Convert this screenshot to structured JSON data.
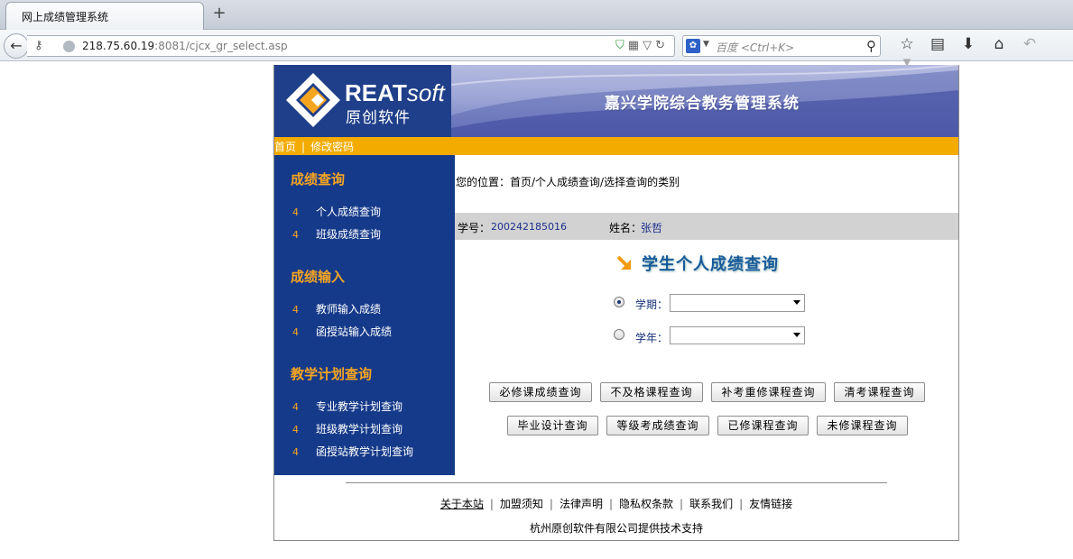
{
  "browser": {
    "tab_title": "网上成绩管理系统",
    "new_tab": "+",
    "url_host": "218.75.60.19",
    "url_rest": ":8081/cjcx_gr_select.asp",
    "search_placeholder": "百度 <Ctrl+K>",
    "search_engine_glyph": "✿"
  },
  "header": {
    "logo_brand": "REAT",
    "logo_brand_italic": "soft",
    "logo_cn": "原创软件",
    "system_title": "嘉兴学院综合教务管理系统",
    "colors": {
      "logo_bg": "#1f3f8a",
      "nav_bar": "#f3ab00",
      "sidebar": "#163a8a",
      "accent": "#f6a521"
    }
  },
  "topnav": {
    "home": "首页",
    "separator": "|",
    "change_password": "修改密码"
  },
  "sidebar": {
    "sections": [
      {
        "title": "成绩查询",
        "items": [
          {
            "bullet": "4",
            "label": "个人成绩查询"
          },
          {
            "bullet": "4",
            "label": "班级成绩查询"
          }
        ]
      },
      {
        "title": "成绩输入",
        "items": [
          {
            "bullet": "4",
            "label": "教师输入成绩"
          },
          {
            "bullet": "4",
            "label": "函授站输入成绩"
          }
        ]
      },
      {
        "title": "教学计划查询",
        "items": [
          {
            "bullet": "4",
            "label": "专业教学计划查询"
          },
          {
            "bullet": "4",
            "label": "班级教学计划查询"
          },
          {
            "bullet": "4",
            "label": "函授站教学计划查询"
          }
        ]
      }
    ]
  },
  "main": {
    "location": "您的位置：首页/个人成绩查询/选择查询的类别",
    "student_id_label": "学号：",
    "student_id": "200242185016",
    "name_label": "姓名：",
    "name": "张哲",
    "query_title": "学生个人成绩查询",
    "term_label": "学期：",
    "term_value": "",
    "year_label": "学年：",
    "year_value": "",
    "selected_option": "学期",
    "buttons_row1": [
      "必修课成绩查询",
      "不及格课程查询",
      "补考重修课程查询",
      "清考课程查询"
    ],
    "buttons_row2": [
      "毕业设计查询",
      "等级考成绩查询",
      "已修课程查询",
      "未修课程查询"
    ]
  },
  "footer": {
    "links": [
      "关于本站",
      "加盟须知",
      "法律声明",
      "隐私权条款",
      "联系我们",
      "友情链接"
    ],
    "separator": "|",
    "support": "杭州原创软件有限公司提供技术支持"
  }
}
